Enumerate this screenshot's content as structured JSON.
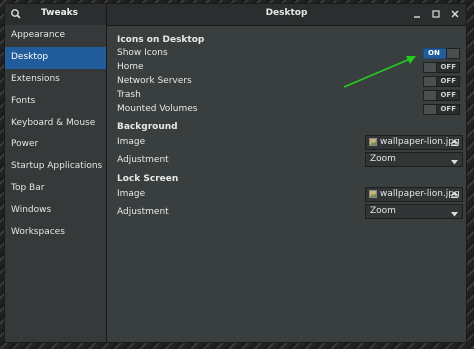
{
  "window": {
    "app_title": "Tweaks",
    "page_title": "Desktop"
  },
  "sidebar": {
    "items": [
      {
        "label": "Appearance"
      },
      {
        "label": "Desktop"
      },
      {
        "label": "Extensions"
      },
      {
        "label": "Fonts"
      },
      {
        "label": "Keyboard & Mouse"
      },
      {
        "label": "Power"
      },
      {
        "label": "Startup Applications"
      },
      {
        "label": "Top Bar"
      },
      {
        "label": "Windows"
      },
      {
        "label": "Workspaces"
      }
    ],
    "selected": "Desktop"
  },
  "icons_on_desktop": {
    "title": "Icons on Desktop",
    "rows": [
      {
        "label": "Show Icons",
        "state": "ON"
      },
      {
        "label": "Home",
        "state": "OFF"
      },
      {
        "label": "Network Servers",
        "state": "OFF"
      },
      {
        "label": "Trash",
        "state": "OFF"
      },
      {
        "label": "Mounted Volumes",
        "state": "OFF"
      }
    ]
  },
  "background": {
    "title": "Background",
    "image_label": "Image",
    "image_file": "wallpaper-lion.jpg",
    "adjustment_label": "Adjustment",
    "adjustment_value": "Zoom"
  },
  "lock_screen": {
    "title": "Lock Screen",
    "image_label": "Image",
    "image_file": "wallpaper-lion.jpg",
    "adjustment_label": "Adjustment",
    "adjustment_value": "Zoom"
  },
  "colors": {
    "accent": "#215d9c",
    "annotation_arrow": "#22cc22"
  },
  "icons": {
    "search": "search-icon",
    "minimize": "minimize-icon",
    "maximize": "maximize-icon",
    "close": "close-icon",
    "file": "image-file-icon",
    "open_folder": "eject-icon",
    "dropdown": "chevron-down-icon"
  }
}
